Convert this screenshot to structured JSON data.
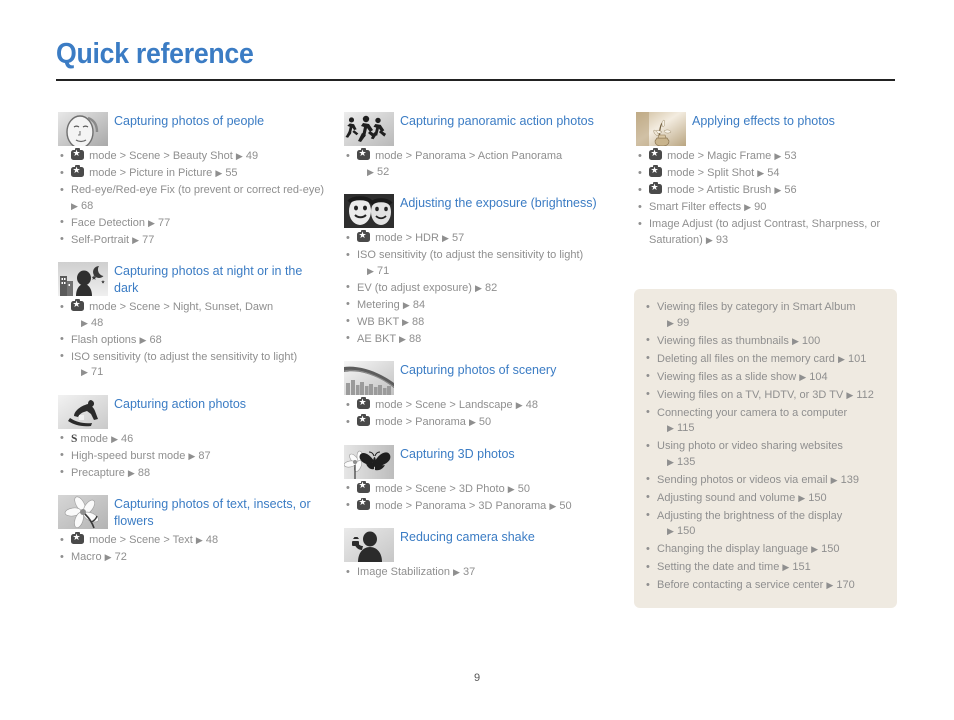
{
  "page": {
    "title": "Quick reference",
    "number": "9",
    "accent_color": "#3b7cc4",
    "text_color": "#8f8f8f",
    "panel_color": "#efeae1"
  },
  "columns": [
    {
      "sections": [
        {
          "icon": "portrait-face-icon",
          "title": "Capturing photos of people",
          "items": [
            {
              "mode": true,
              "text": "mode > Scene > Beauty Shot",
              "page": "49"
            },
            {
              "mode": true,
              "text": "mode > Picture in Picture",
              "page": "55"
            },
            {
              "mode": false,
              "text": "Red-eye/Red-eye Fix (to prevent or correct red-eye)",
              "page": "68"
            },
            {
              "mode": false,
              "text": "Face Detection",
              "page": "77"
            },
            {
              "mode": false,
              "text": "Self-Portrait",
              "page": "77"
            }
          ]
        },
        {
          "icon": "night-scene-icon",
          "title": "Capturing photos at night or in the dark",
          "items": [
            {
              "mode": true,
              "text": "mode > Scene > Night, Sunset, Dawn",
              "page": "48",
              "wrap": true
            },
            {
              "mode": false,
              "text": "Flash options",
              "page": "68"
            },
            {
              "mode": false,
              "text": "ISO sensitivity (to adjust the sensitivity to light)",
              "page": "71",
              "wrap": true
            }
          ]
        },
        {
          "icon": "snowboarder-action-icon",
          "title": "Capturing action photos",
          "items": [
            {
              "smode": true,
              "text": "mode",
              "page": "46"
            },
            {
              "mode": false,
              "text": "High-speed burst mode",
              "page": "87"
            },
            {
              "mode": false,
              "text": "Precapture",
              "page": "88"
            }
          ]
        },
        {
          "icon": "flower-macro-icon",
          "title": "Capturing photos of text, insects, or flowers",
          "items": [
            {
              "mode": true,
              "text": "mode > Scene > Text",
              "page": "48"
            },
            {
              "mode": false,
              "text": "Macro",
              "page": "72"
            }
          ]
        }
      ]
    },
    {
      "sections": [
        {
          "icon": "running-people-icon",
          "title": "Capturing panoramic action photos",
          "items": [
            {
              "mode": true,
              "text": "mode > Panorama > Action Panorama",
              "page": "52",
              "wrap": true
            }
          ]
        },
        {
          "icon": "two-faces-icon",
          "title": "Adjusting the exposure (brightness)",
          "items": [
            {
              "mode": true,
              "text": "mode > HDR",
              "page": "57"
            },
            {
              "mode": false,
              "text": "ISO sensitivity (to adjust the sensitivity to light)",
              "page": "71",
              "wrap": true
            },
            {
              "mode": false,
              "text": "EV (to adjust exposure)",
              "page": "82"
            },
            {
              "mode": false,
              "text": "Metering",
              "page": "84"
            },
            {
              "mode": false,
              "text": "WB BKT",
              "page": "88"
            },
            {
              "mode": false,
              "text": "AE BKT",
              "page": "88"
            }
          ]
        },
        {
          "icon": "bridge-cityscape-icon",
          "title": "Capturing photos of scenery",
          "items": [
            {
              "mode": true,
              "text": "mode > Scene > Landscape",
              "page": "48"
            },
            {
              "mode": true,
              "text": "mode > Panorama",
              "page": "50"
            }
          ]
        },
        {
          "icon": "butterfly-3d-icon",
          "title": "Capturing 3D photos",
          "items": [
            {
              "mode": true,
              "text": "mode > Scene > 3D Photo",
              "page": "50"
            },
            {
              "mode": true,
              "text": "mode > Panorama > 3D Panorama",
              "page": "50"
            }
          ]
        },
        {
          "icon": "camera-shake-person-icon",
          "title": "Reducing camera shake",
          "items": [
            {
              "mode": false,
              "text": "Image Stabilization",
              "page": "37"
            }
          ]
        }
      ]
    },
    {
      "sections": [
        {
          "icon": "vase-flowers-effect-icon",
          "title": "Applying effects to photos",
          "items": [
            {
              "mode": true,
              "text": "mode > Magic Frame",
              "page": "53"
            },
            {
              "mode": true,
              "text": "mode > Split Shot",
              "page": "54"
            },
            {
              "mode": true,
              "text": "mode > Artistic Brush",
              "page": "56"
            },
            {
              "mode": false,
              "text": "Smart Filter effects",
              "page": "90"
            },
            {
              "mode": false,
              "text": "Image Adjust (to adjust Contrast, Sharpness, or Saturation)",
              "page": "93"
            }
          ]
        }
      ]
    }
  ],
  "tip_panel": {
    "items": [
      {
        "text": "Viewing files by category in Smart Album",
        "page": "99",
        "wrap": true
      },
      {
        "text": "Viewing files as thumbnails",
        "page": "100"
      },
      {
        "text": "Deleting all files on the memory card",
        "page": "101"
      },
      {
        "text": "Viewing files as a slide show",
        "page": "104"
      },
      {
        "text": "Viewing files on a TV, HDTV, or 3D TV",
        "page": "112"
      },
      {
        "text": "Connecting your camera to a computer",
        "page": "115",
        "wrap": true
      },
      {
        "text": "Using photo or video sharing websites",
        "page": "135",
        "wrap": true
      },
      {
        "text": "Sending photos or videos via email",
        "page": "139"
      },
      {
        "text": "Adjusting sound and volume",
        "page": "150"
      },
      {
        "text": "Adjusting the brightness of the display",
        "page": "150",
        "wrap": true
      },
      {
        "text": "Changing the display language",
        "page": "150"
      },
      {
        "text": "Setting the date and time",
        "page": "151"
      },
      {
        "text": "Before contacting a service center",
        "page": "170"
      }
    ]
  }
}
